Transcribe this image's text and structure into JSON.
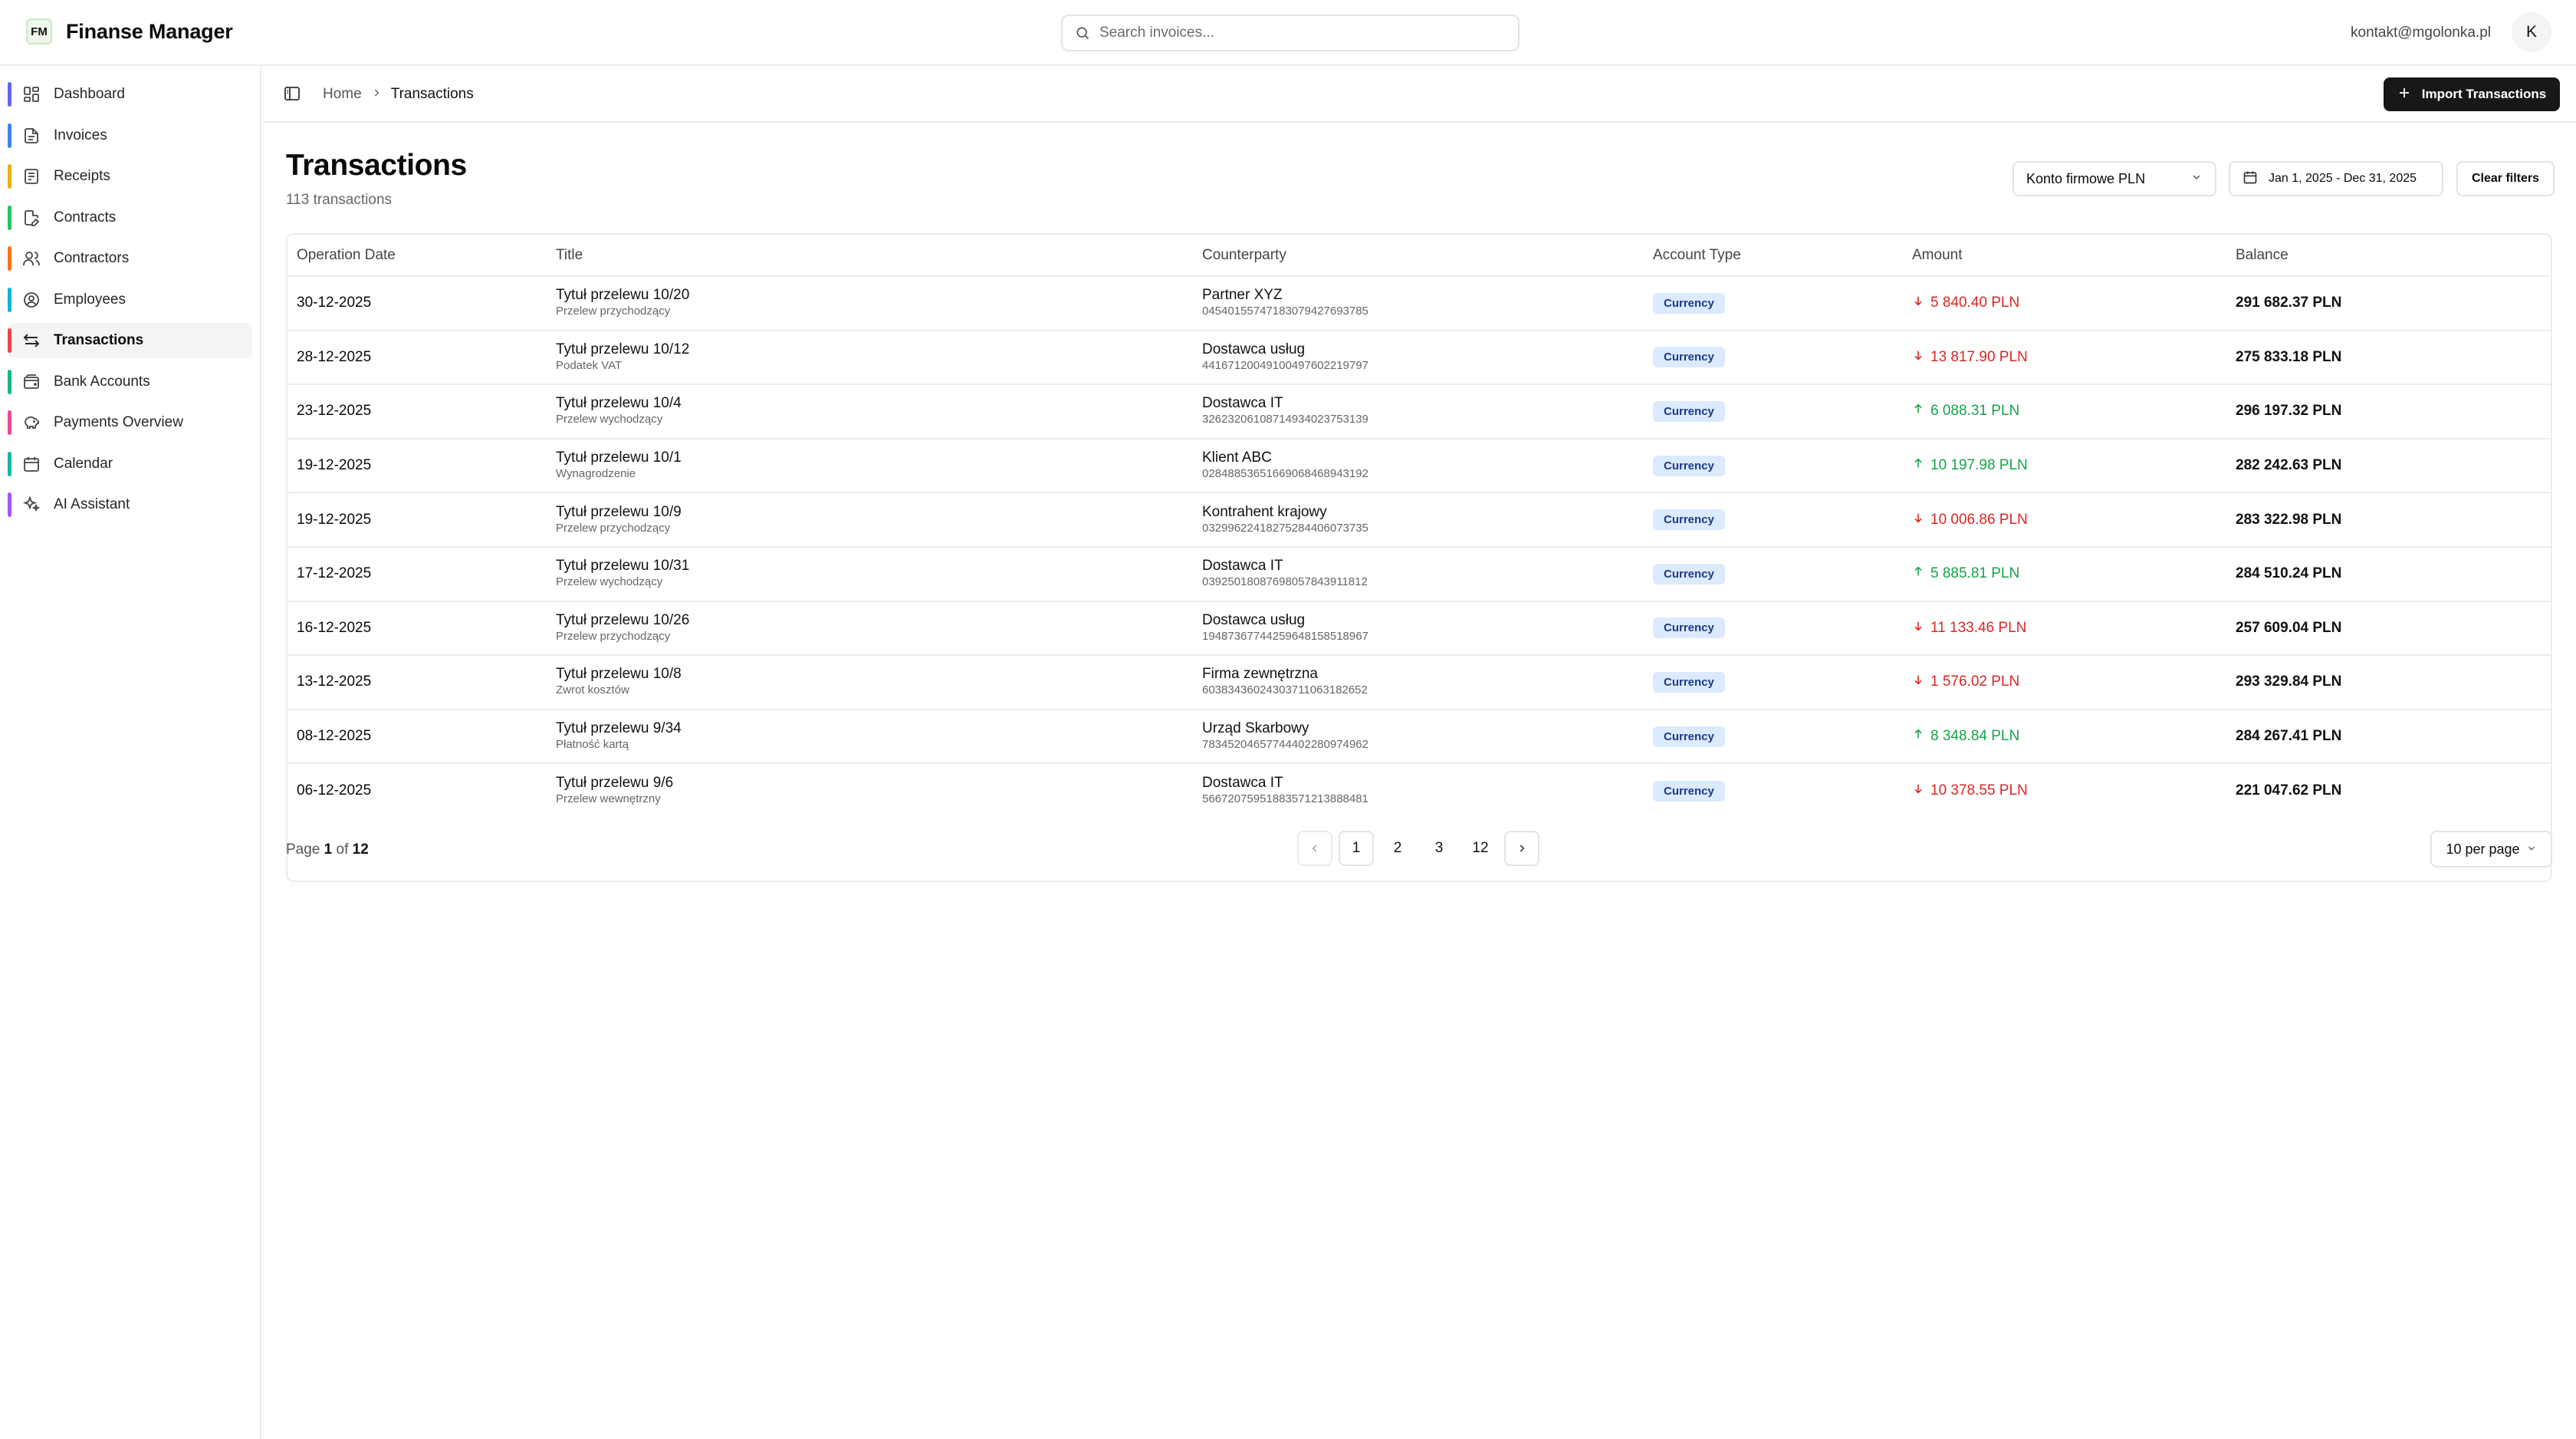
{
  "app": {
    "logo": "FM",
    "name": "Finanse Manager"
  },
  "search": {
    "placeholder": "Search invoices..."
  },
  "user": {
    "email": "kontakt@mgolonka.pl",
    "initial": "K"
  },
  "sidebar": {
    "items": [
      {
        "label": "Dashboard",
        "icon": "dashboard-icon",
        "color": "#6366f1"
      },
      {
        "label": "Invoices",
        "icon": "file-icon",
        "color": "#3b82f6"
      },
      {
        "label": "Receipts",
        "icon": "receipt-icon",
        "color": "#eab308"
      },
      {
        "label": "Contracts",
        "icon": "contract-icon",
        "color": "#22c55e"
      },
      {
        "label": "Contractors",
        "icon": "users-icon",
        "color": "#f97316"
      },
      {
        "label": "Employees",
        "icon": "user-circle-icon",
        "color": "#06b6d4"
      },
      {
        "label": "Transactions",
        "icon": "arrows-icon",
        "color": "#ef4444",
        "active": true
      },
      {
        "label": "Bank Accounts",
        "icon": "wallet-icon",
        "color": "#10b981"
      },
      {
        "label": "Payments Overview",
        "icon": "piggy-icon",
        "color": "#ec4899"
      },
      {
        "label": "Calendar",
        "icon": "calendar-icon",
        "color": "#14b8a6"
      },
      {
        "label": "AI Assistant",
        "icon": "sparkle-icon",
        "color": "#a855f7"
      }
    ]
  },
  "breadcrumb": {
    "home": "Home",
    "current": "Transactions"
  },
  "actions": {
    "import_label": "Import Transactions"
  },
  "page": {
    "title": "Transactions",
    "subtitle": "113 transactions"
  },
  "filters": {
    "account": "Konto firmowe PLN",
    "date_range": "Jan 1, 2025 - Dec 31, 2025",
    "clear": "Clear filters"
  },
  "table": {
    "columns": [
      "Operation Date",
      "Title",
      "Counterparty",
      "Account Type",
      "Amount",
      "Balance"
    ],
    "rows": [
      {
        "date": "30-12-2025",
        "title": "Tytuł przelewu 10/20",
        "subtitle": "Przelew przychodzący",
        "counterparty": "Partner XYZ",
        "account": "04540155747183079427693785",
        "type": "Currency",
        "amount": "5 840.40 PLN",
        "direction": "neg",
        "balance": "291 682.37 PLN"
      },
      {
        "date": "28-12-2025",
        "title": "Tytuł przelewu 10/12",
        "subtitle": "Podatek VAT",
        "counterparty": "Dostawca usług",
        "account": "44167120049100497602219797",
        "type": "Currency",
        "amount": "13 817.90 PLN",
        "direction": "neg",
        "balance": "275 833.18 PLN"
      },
      {
        "date": "23-12-2025",
        "title": "Tytuł przelewu 10/4",
        "subtitle": "Przelew wychodzący",
        "counterparty": "Dostawca IT",
        "account": "32623206108714934023753139",
        "type": "Currency",
        "amount": "6 088.31 PLN",
        "direction": "pos",
        "balance": "296 197.32 PLN"
      },
      {
        "date": "19-12-2025",
        "title": "Tytuł przelewu 10/1",
        "subtitle": "Wynagrodzenie",
        "counterparty": "Klient ABC",
        "account": "02848853651669068468943192",
        "type": "Currency",
        "amount": "10 197.98 PLN",
        "direction": "pos",
        "balance": "282 242.63 PLN"
      },
      {
        "date": "19-12-2025",
        "title": "Tytuł przelewu 10/9",
        "subtitle": "Przelew przychodzący",
        "counterparty": "Kontrahent krajowy",
        "account": "03299622418275284406073735",
        "type": "Currency",
        "amount": "10 006.86 PLN",
        "direction": "neg",
        "balance": "283 322.98 PLN"
      },
      {
        "date": "17-12-2025",
        "title": "Tytuł przelewu 10/31",
        "subtitle": "Przelew wychodzący",
        "counterparty": "Dostawca IT",
        "account": "03925018087698057843911812",
        "type": "Currency",
        "amount": "5 885.81 PLN",
        "direction": "pos",
        "balance": "284 510.24 PLN"
      },
      {
        "date": "16-12-2025",
        "title": "Tytuł przelewu 10/26",
        "subtitle": "Przelew przychodzący",
        "counterparty": "Dostawca usług",
        "account": "19487367744259648158518967",
        "type": "Currency",
        "amount": "11 133.46 PLN",
        "direction": "neg",
        "balance": "257 609.04 PLN"
      },
      {
        "date": "13-12-2025",
        "title": "Tytuł przelewu 10/8",
        "subtitle": "Zwrot kosztów",
        "counterparty": "Firma zewnętrzna",
        "account": "60383436024303711063182652",
        "type": "Currency",
        "amount": "1 576.02 PLN",
        "direction": "neg",
        "balance": "293 329.84 PLN"
      },
      {
        "date": "08-12-2025",
        "title": "Tytuł przelewu 9/34",
        "subtitle": "Płatność kartą",
        "counterparty": "Urząd Skarbowy",
        "account": "78345204657744402280974962",
        "type": "Currency",
        "amount": "8 348.84 PLN",
        "direction": "pos",
        "balance": "284 267.41 PLN"
      },
      {
        "date": "06-12-2025",
        "title": "Tytuł przelewu 9/6",
        "subtitle": "Przelew wewnętrzny",
        "counterparty": "Dostawca IT",
        "account": "56672075951883571213888481",
        "type": "Currency",
        "amount": "10 378.55 PLN",
        "direction": "neg",
        "balance": "221 047.62 PLN"
      }
    ]
  },
  "pagination": {
    "prefix": "Page",
    "current": "1",
    "of": "of",
    "total": "12",
    "pages": [
      "1",
      "2",
      "3",
      "12"
    ],
    "per_page": "10 per page"
  }
}
